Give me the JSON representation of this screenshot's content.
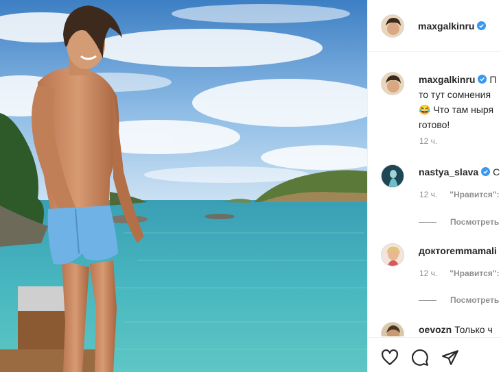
{
  "post": {
    "author": "maxgalkinru",
    "verified": true
  },
  "comments": [
    {
      "username": "maxgalkinru",
      "verified": true,
      "lines": [
        "П",
        "то тут сомнения",
        "😂 Что там ныря",
        "готово!"
      ],
      "time": "12 ч."
    },
    {
      "username": "nastya_slava",
      "verified": true,
      "text": "С",
      "time": "12 ч.",
      "likes": "\"Нравится\":",
      "replies": "Посмотреть"
    },
    {
      "username": "доктoremmamali",
      "verified": false,
      "text": "",
      "time": "12 ч.",
      "likes": "\"Нравится\":",
      "replies": "Посмотреть"
    },
    {
      "username": "oevozn",
      "verified": false,
      "text": "Только ч"
    }
  ],
  "actions": {
    "like_icon": "heart-icon",
    "comment_icon": "comment-icon",
    "share_icon": "paper-plane-icon"
  },
  "colors": {
    "verified": "#3897f0",
    "muted": "#8e8e8e",
    "text": "#262626"
  }
}
